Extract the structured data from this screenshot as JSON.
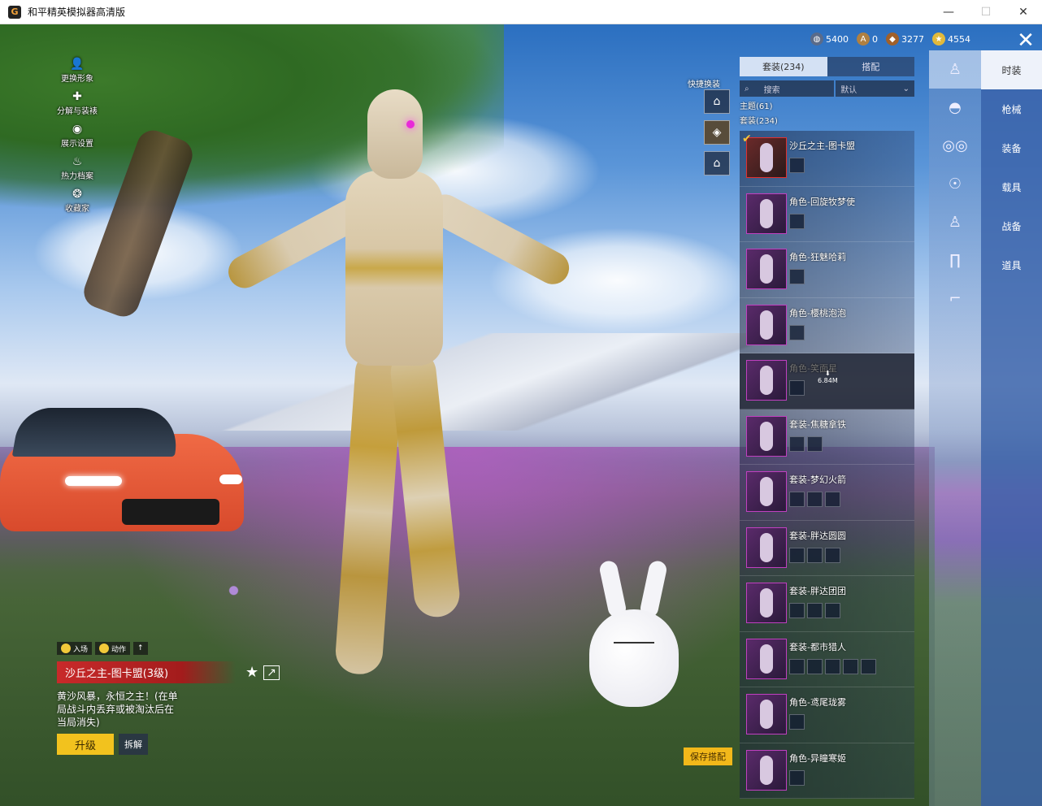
{
  "window": {
    "title": "和平精英模拟器高清版",
    "min": "—",
    "max": "☐",
    "close": "✕"
  },
  "left_menu": [
    {
      "icon": "person-icon",
      "glyph": "👤",
      "label": "更换形象"
    },
    {
      "icon": "puzzle-icon",
      "glyph": "✚",
      "label": "分解与装裱"
    },
    {
      "icon": "eye-icon",
      "glyph": "◉",
      "label": "展示设置"
    },
    {
      "icon": "flame-icon",
      "glyph": "♨",
      "label": "热力档案"
    },
    {
      "icon": "badge-icon",
      "glyph": "❂",
      "label": "收藏家"
    }
  ],
  "currency": [
    {
      "icon": "globe-coin-icon",
      "value": "5400",
      "color": "#5a6b8a"
    },
    {
      "icon": "a-coin-icon",
      "value": "0",
      "color": "#b08040"
    },
    {
      "icon": "bronze-coin-icon",
      "value": "3277",
      "color": "#a0602a"
    },
    {
      "icon": "gold-coin-icon",
      "value": "4554",
      "color": "#e2b93a"
    }
  ],
  "close_glyph": "✕",
  "quick_swap": {
    "label": "快捷换装"
  },
  "panel": {
    "tabs": [
      "套装(234)",
      "搭配"
    ],
    "search_placeholder": "搜索",
    "sort": "默认",
    "meta_theme": "主题(61)",
    "meta_suits": "套装(234)",
    "items": [
      {
        "name": "沙丘之主-图卡盟",
        "subs": 1,
        "frame": "red",
        "selected": true,
        "dark": false
      },
      {
        "name": "角色-回旋牧梦使",
        "subs": 1,
        "frame": "purple",
        "selected": false,
        "dark": false
      },
      {
        "name": "角色-狂魅哈莉",
        "subs": 1,
        "frame": "purple",
        "selected": false,
        "dark": false
      },
      {
        "name": "角色-樱桃泡泡",
        "subs": 1,
        "frame": "purple",
        "selected": false,
        "dark": false
      },
      {
        "name": "角色-笑面星",
        "subs": 1,
        "frame": "purple",
        "selected": false,
        "dark": true,
        "download": "6.84M"
      },
      {
        "name": "套装-焦糖拿铁",
        "subs": 2,
        "frame": "purple",
        "selected": false,
        "dark": false
      },
      {
        "name": "套装-梦幻火箭",
        "subs": 3,
        "frame": "purple",
        "selected": false,
        "dark": false
      },
      {
        "name": "套装-胖达圆圆",
        "subs": 3,
        "frame": "purple",
        "selected": false,
        "dark": false
      },
      {
        "name": "套装-胖达团团",
        "subs": 3,
        "frame": "purple",
        "selected": false,
        "dark": false
      },
      {
        "name": "套装-都市猎人",
        "subs": 5,
        "frame": "purple",
        "selected": false,
        "dark": false
      },
      {
        "name": "角色-鸢尾珑雾",
        "subs": 1,
        "frame": "purple",
        "selected": false,
        "dark": false
      },
      {
        "name": "角色-异瞳寒姬",
        "subs": 1,
        "frame": "purple",
        "selected": false,
        "dark": false
      }
    ]
  },
  "categories": [
    "outfit-icon",
    "cap-icon",
    "glasses-icon",
    "mask-icon",
    "top-icon",
    "pants-icon",
    "shoes-icon"
  ],
  "tabs": [
    "时装",
    "枪械",
    "装备",
    "载具",
    "战备",
    "道具"
  ],
  "save_button": "保存搭配",
  "info": {
    "chip1": "入场",
    "chip2": "动作",
    "chip3": "↑",
    "name": "沙丘之主-图卡盟(3级)",
    "desc": "黄沙风暴，永恒之主！(在单局战斗内丢弃或被淘汰后在当局消失)",
    "upgrade": "升级",
    "dismantle": "拆解"
  }
}
